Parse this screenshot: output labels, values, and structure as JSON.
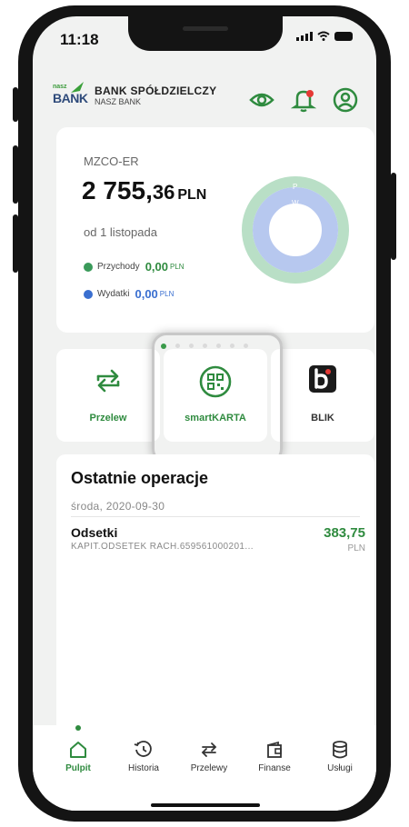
{
  "status": {
    "time": "11:18"
  },
  "header": {
    "logo_small": "nasz",
    "logo_big": "BANK",
    "bank_name": "BANK SPÓŁDZIELCZY",
    "bank_subname": "NASZ BANK"
  },
  "account": {
    "name": "MZCO-ER",
    "balance_main": "2 755,",
    "balance_cents": "36",
    "currency": "PLN",
    "period": "od 1 listopada",
    "income_label": "Przychody",
    "income_value": "0,00",
    "income_unit": "PLN",
    "expense_label": "Wydatki",
    "expense_value": "0,00",
    "expense_unit": "PLN",
    "donut_label_p": "P",
    "donut_label_w": "W"
  },
  "actions": {
    "transfer": "Przelew",
    "smartkarta": "smartKARTA",
    "blik": "BLIK"
  },
  "operations": {
    "title": "Ostatnie operacje",
    "date": "środa, 2020-09-30",
    "items": [
      {
        "name": "Odsetki",
        "description": "KAPIT.ODSETEK RACH.659561000201...",
        "amount": "383,75",
        "currency": "PLN"
      }
    ]
  },
  "tabbar": {
    "items": [
      {
        "label": "Pulpit",
        "icon": "home-icon"
      },
      {
        "label": "Historia",
        "icon": "history-icon"
      },
      {
        "label": "Przelewy",
        "icon": "transfer-icon"
      },
      {
        "label": "Finanse",
        "icon": "wallet-icon"
      },
      {
        "label": "Usługi",
        "icon": "database-icon"
      }
    ]
  },
  "colors": {
    "accent": "#2f8b3f",
    "income": "#3a9a5a",
    "expense": "#3a6fd0"
  }
}
